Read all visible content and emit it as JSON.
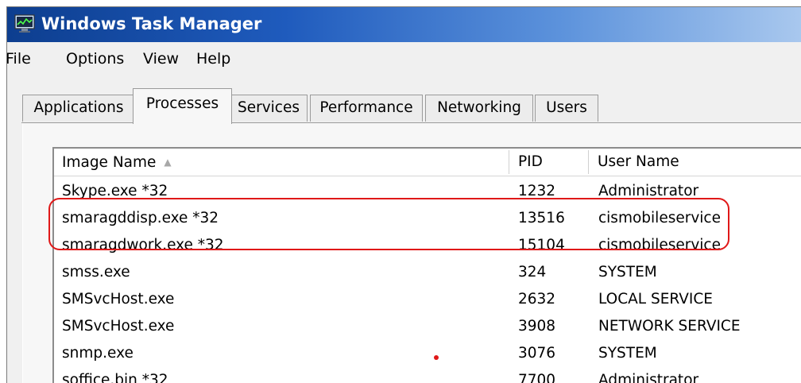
{
  "window": {
    "title": "Windows Task Manager"
  },
  "menu": [
    "File",
    "Options",
    "View",
    "Help"
  ],
  "tabs": [
    "Applications",
    "Processes",
    "Services",
    "Performance",
    "Networking",
    "Users"
  ],
  "active_tab": "Processes",
  "columns": [
    "Image Name",
    "PID",
    "User Name"
  ],
  "sort": {
    "column": "Image Name",
    "direction": "ascending"
  },
  "rows": [
    {
      "name": "Skype.exe *32",
      "pid": "1232",
      "user": "Administrator"
    },
    {
      "name": "smaragddisp.exe *32",
      "pid": "13516",
      "user": "cismobileservice"
    },
    {
      "name": "smaragdwork.exe *32",
      "pid": "15104",
      "user": "cismobileservice"
    },
    {
      "name": "smss.exe",
      "pid": "324",
      "user": "SYSTEM"
    },
    {
      "name": "SMSvcHost.exe",
      "pid": "2632",
      "user": "LOCAL SERVICE"
    },
    {
      "name": "SMSvcHost.exe",
      "pid": "3908",
      "user": "NETWORK SERVICE"
    },
    {
      "name": "snmp.exe",
      "pid": "3076",
      "user": "SYSTEM"
    },
    {
      "name": "soffice.bin *32",
      "pid": "7700",
      "user": "Administrator"
    }
  ],
  "annotation": {
    "color": "#e01818",
    "highlighted_rows": [
      1,
      2
    ]
  },
  "colors": {
    "title_bar": "#1f5bbd",
    "title_text": "#ffffff"
  }
}
